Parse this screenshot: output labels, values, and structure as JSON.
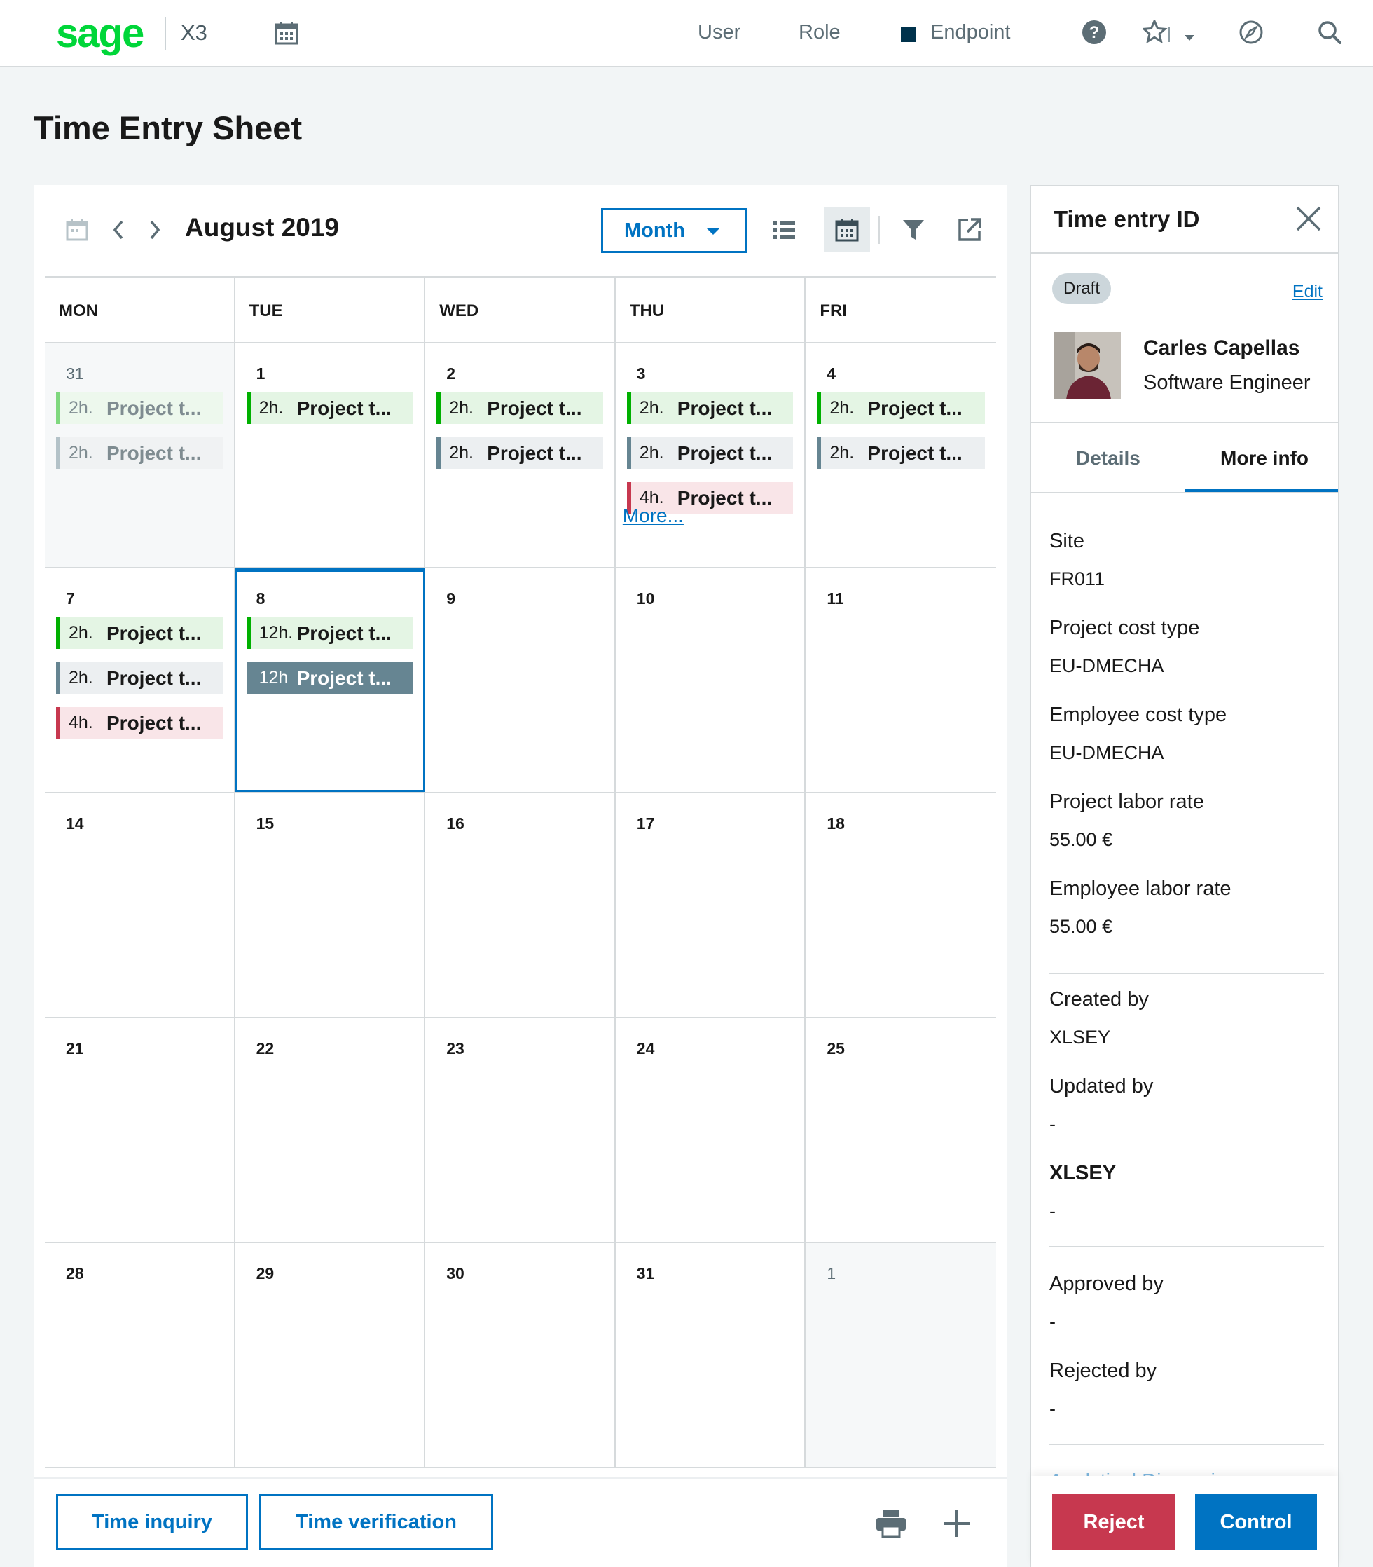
{
  "topbar": {
    "logo": "sage",
    "product": "X3",
    "nav": [
      "User",
      "Role",
      "Endpoint"
    ],
    "colors": {
      "brand": "#00d639",
      "endpoint": "#00324c"
    },
    "icons": [
      "calendar-icon",
      "help-icon",
      "star-icon",
      "chevron-down-icon",
      "compass-icon",
      "search-icon"
    ]
  },
  "page": {
    "title": "Time Entry Sheet"
  },
  "calendar": {
    "month_label": "August 2019",
    "view_select": "Month",
    "weekdays": [
      "MON",
      "TUE",
      "WED",
      "THU",
      "FRI"
    ],
    "more_link": "More...",
    "weeks": [
      [
        {
          "day": "31",
          "out": true,
          "entries": [
            {
              "hrs": "2h.",
              "label": "Project t...",
              "color": "green"
            },
            {
              "hrs": "2h.",
              "label": "Project t...",
              "color": "grey"
            }
          ]
        },
        {
          "day": "1",
          "entries": [
            {
              "hrs": "2h.",
              "label": "Project t...",
              "color": "green"
            }
          ]
        },
        {
          "day": "2",
          "entries": [
            {
              "hrs": "2h.",
              "label": "Project t...",
              "color": "green"
            },
            {
              "hrs": "2h.",
              "label": "Project t...",
              "color": "grey"
            }
          ]
        },
        {
          "day": "3",
          "more": true,
          "entries": [
            {
              "hrs": "2h.",
              "label": "Project t...",
              "color": "green"
            },
            {
              "hrs": "2h.",
              "label": "Project t...",
              "color": "grey"
            },
            {
              "hrs": "4h.",
              "label": "Project t...",
              "color": "red"
            }
          ]
        },
        {
          "day": "4",
          "entries": [
            {
              "hrs": "2h.",
              "label": "Project t...",
              "color": "green"
            },
            {
              "hrs": "2h.",
              "label": "Project t...",
              "color": "grey"
            }
          ]
        }
      ],
      [
        {
          "day": "7",
          "entries": [
            {
              "hrs": "2h.",
              "label": "Project t...",
              "color": "green"
            },
            {
              "hrs": "2h.",
              "label": "Project t...",
              "color": "grey"
            },
            {
              "hrs": "4h.",
              "label": "Project t...",
              "color": "red"
            }
          ]
        },
        {
          "day": "8",
          "selected": true,
          "entries": [
            {
              "hrs": "12h.",
              "label": "Project t...",
              "color": "green"
            },
            {
              "hrs": "12h",
              "label": "Project t...",
              "color": "dark"
            }
          ]
        },
        {
          "day": "9",
          "entries": []
        },
        {
          "day": "10",
          "entries": []
        },
        {
          "day": "11",
          "entries": []
        }
      ],
      [
        {
          "day": "14",
          "entries": []
        },
        {
          "day": "15",
          "entries": []
        },
        {
          "day": "16",
          "entries": []
        },
        {
          "day": "17",
          "entries": []
        },
        {
          "day": "18",
          "entries": []
        }
      ],
      [
        {
          "day": "21",
          "entries": []
        },
        {
          "day": "22",
          "entries": []
        },
        {
          "day": "23",
          "entries": []
        },
        {
          "day": "24",
          "entries": []
        },
        {
          "day": "25",
          "entries": []
        }
      ],
      [
        {
          "day": "28",
          "entries": []
        },
        {
          "day": "29",
          "entries": []
        },
        {
          "day": "30",
          "entries": []
        },
        {
          "day": "31",
          "entries": []
        },
        {
          "day": "1",
          "out": true,
          "entries": []
        }
      ]
    ],
    "footer": {
      "time_inquiry": "Time inquiry",
      "time_verification": "Time verification"
    }
  },
  "side": {
    "title": "Time entry ID",
    "status": "Draft",
    "edit": "Edit",
    "person": {
      "name": "Carles Capellas",
      "role": "Software Engineer"
    },
    "tabs": {
      "details": "Details",
      "more_info": "More info",
      "active": "More info"
    },
    "fields": [
      {
        "label": "Site",
        "value": "FR011"
      },
      {
        "label": "Project cost type",
        "value": "EU-DMECHA"
      },
      {
        "label": "Employee cost type",
        "value": "EU-DMECHA"
      },
      {
        "label": "Project labor rate",
        "value": "55.00 €"
      },
      {
        "label": "Employee labor rate",
        "value": "55.00 €"
      }
    ],
    "audit1": [
      {
        "label": "Created by",
        "value": "XLSEY"
      },
      {
        "label": "Updated by",
        "value": "-"
      },
      {
        "label": "XLSEY",
        "value": "-"
      }
    ],
    "audit2": [
      {
        "label": "Approved by",
        "value": "-"
      },
      {
        "label": "Rejected by",
        "value": "-"
      }
    ],
    "faded_next": "Analytical Dimensions",
    "buttons": {
      "reject": "Reject",
      "control": "Control"
    },
    "colors": {
      "reject": "#c7384f",
      "control": "#0073c2"
    }
  }
}
